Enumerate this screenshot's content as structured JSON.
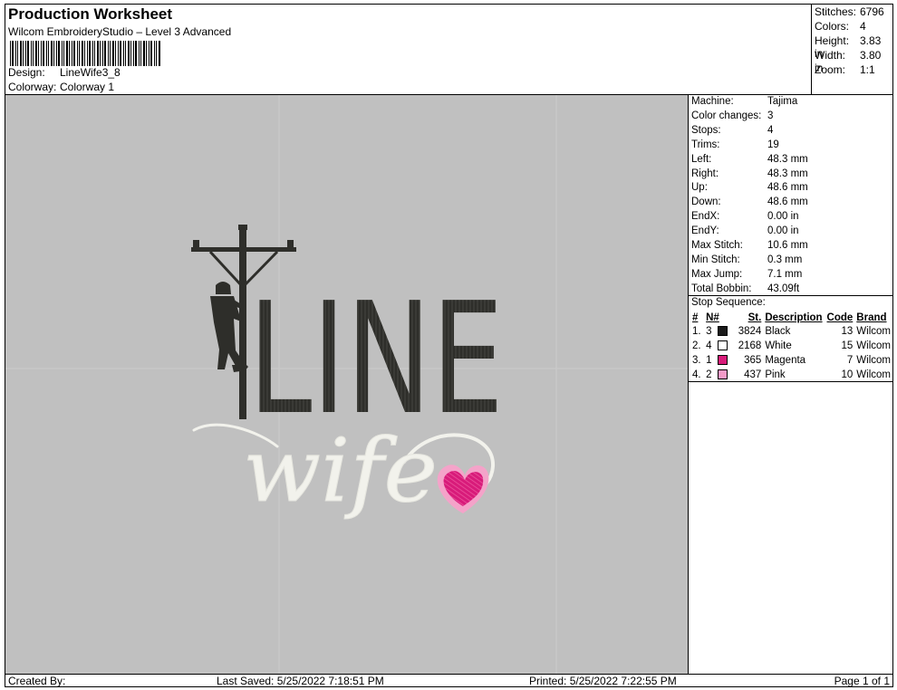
{
  "header": {
    "title": "Production Worksheet",
    "subtitle": "Wilcom EmbroideryStudio – Level 3 Advanced",
    "design_label": "Design:",
    "design_value": "LineWife3_8",
    "colorway_label": "Colorway:",
    "colorway_value": "Colorway 1"
  },
  "stats": [
    {
      "label": "Stitches:",
      "value": "6796"
    },
    {
      "label": "Colors:",
      "value": "4"
    },
    {
      "label": "Height:",
      "value": "3.83 in"
    },
    {
      "label": "Width:",
      "value": "3.80 in"
    },
    {
      "label": "Zoom:",
      "value": "1:1"
    }
  ],
  "machine": [
    {
      "label": "Machine:",
      "value": "Tajima"
    },
    {
      "label": "Color changes:",
      "value": "3"
    },
    {
      "label": "Stops:",
      "value": "4"
    },
    {
      "label": "Trims:",
      "value": "19"
    },
    {
      "label": "Left:",
      "value": "48.3 mm"
    },
    {
      "label": "Right:",
      "value": "48.3 mm"
    },
    {
      "label": "Up:",
      "value": "48.6 mm"
    },
    {
      "label": "Down:",
      "value": "48.6 mm"
    },
    {
      "label": "EndX:",
      "value": "0.00 in"
    },
    {
      "label": "EndY:",
      "value": "0.00 in"
    },
    {
      "label": "Max Stitch:",
      "value": "10.6 mm"
    },
    {
      "label": "Min Stitch:",
      "value": "0.3 mm"
    },
    {
      "label": "Max Jump:",
      "value": "7.1 mm"
    },
    {
      "label": "Total Bobbin:",
      "value": "43.09ft"
    }
  ],
  "stop_sequence": {
    "label": "Stop Sequence:",
    "headers": {
      "num": "#",
      "n": "N#",
      "st": "St.",
      "desc": "Description",
      "code": "Code",
      "brand": "Brand"
    },
    "rows": [
      {
        "num": "1.",
        "n": "3",
        "st": "3824",
        "desc": "Black",
        "code": "13",
        "brand": "Wilcom",
        "color": "#1a1a1a"
      },
      {
        "num": "2.",
        "n": "4",
        "st": "2168",
        "desc": "White",
        "code": "15",
        "brand": "Wilcom",
        "color": "#ffffff"
      },
      {
        "num": "3.",
        "n": "1",
        "st": "365",
        "desc": "Magenta",
        "code": "7",
        "brand": "Wilcom",
        "color": "#d81b7a"
      },
      {
        "num": "4.",
        "n": "2",
        "st": "437",
        "desc": "Pink",
        "code": "10",
        "brand": "Wilcom",
        "color": "#f39ac7"
      }
    ]
  },
  "design": {
    "word_line": "LINE",
    "word_wife": "wife",
    "thread_black": "#2e2e2a",
    "thread_white": "#f2f2ec",
    "thread_magenta": "#d81b7a",
    "thread_pink": "#f4a3c9",
    "background": "#c0c0c0"
  },
  "footer": {
    "created_by": "Created By:",
    "last_saved": "Last Saved: 5/25/2022 7:18:51 PM",
    "printed": "Printed: 5/25/2022 7:22:55 PM",
    "page": "Page 1 of 1"
  }
}
